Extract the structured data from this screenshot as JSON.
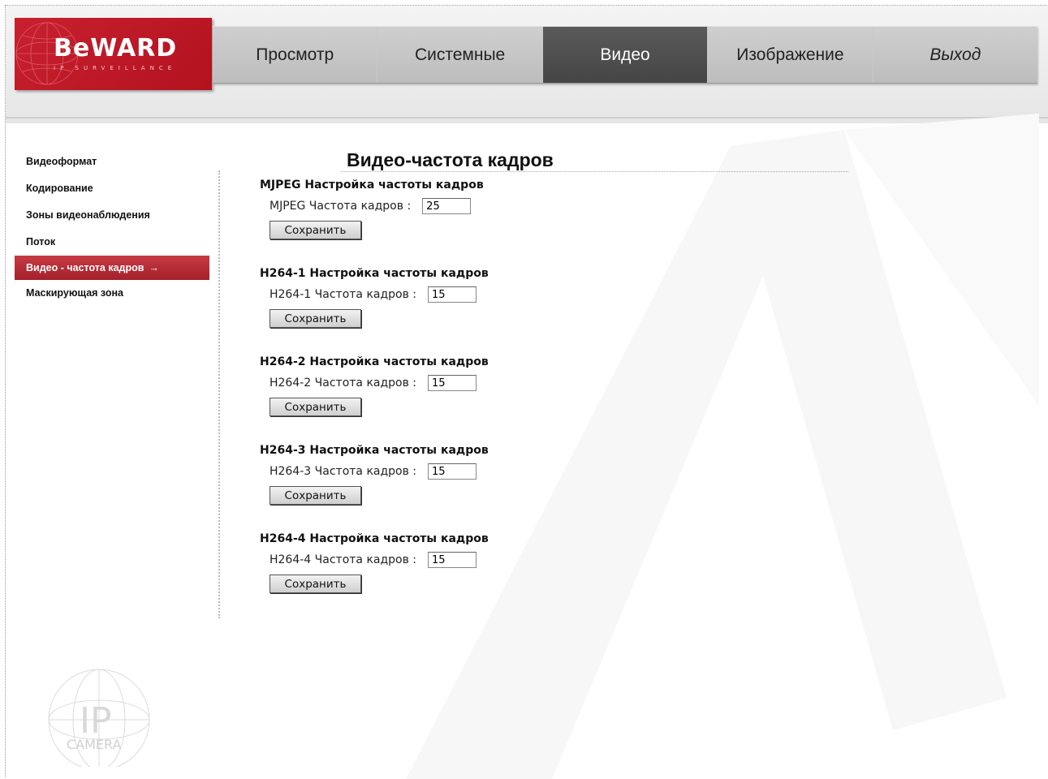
{
  "brand": {
    "name": "BeWARD",
    "tagline": "IP SURVEILLANCE"
  },
  "nav": {
    "tabs": [
      {
        "label": "Просмотр"
      },
      {
        "label": "Системные"
      },
      {
        "label": "Видео"
      },
      {
        "label": "Изображение"
      },
      {
        "label": "Выход"
      }
    ],
    "active": "Видео"
  },
  "sidebar": {
    "items": [
      {
        "label": "Видеоформат"
      },
      {
        "label": "Кодирование"
      },
      {
        "label": "Зоны видеонаблюдения"
      },
      {
        "label": "Поток"
      },
      {
        "label": "Видео - частота кадров"
      },
      {
        "label": "Маскирующая зона"
      }
    ],
    "active": "Видео - частота кадров",
    "active_arrow": "→"
  },
  "page": {
    "title": "Видео-частота кадров"
  },
  "sections": [
    {
      "title": "MJPEG Настройка частоты кадров",
      "field_label": "MJPEG Частота кадров :",
      "value": "25",
      "button": "Сохранить"
    },
    {
      "title": "H264-1 Настройка частоты кадров",
      "field_label": "H264-1 Частота кадров :",
      "value": "15",
      "button": "Сохранить"
    },
    {
      "title": "H264-2 Настройка частоты кадров",
      "field_label": "H264-2 Частота кадров :",
      "value": "15",
      "button": "Сохранить"
    },
    {
      "title": "H264-3 Настройка частоты кадров",
      "field_label": "H264-3 Частота кадров :",
      "value": "15",
      "button": "Сохранить"
    },
    {
      "title": "H264-4 Настройка частоты кадров",
      "field_label": "H264-4 Частота кадров :",
      "value": "15",
      "button": "Сохранить"
    }
  ],
  "footer_logo": {
    "line1": "IP",
    "line2": "CAMERA"
  },
  "colors": {
    "brand_red": "#c8202f",
    "active_tab": "#4f4f4f",
    "sidebar_active": "#b62a34"
  }
}
